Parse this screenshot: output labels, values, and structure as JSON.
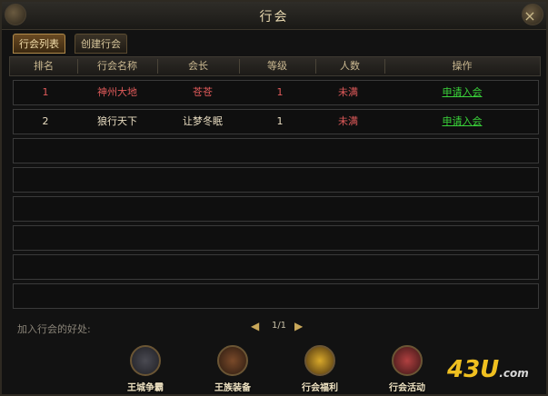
{
  "window": {
    "title": "行会"
  },
  "tabs": [
    {
      "label": "行会列表",
      "active": true
    },
    {
      "label": "创建行会",
      "active": false
    }
  ],
  "table": {
    "headers": [
      "排名",
      "行会名称",
      "会长",
      "等级",
      "人数",
      "操作"
    ],
    "rows": [
      {
        "rank": "1",
        "name": "神州大地",
        "leader": "苍苍",
        "level": "1",
        "people": "未满",
        "action": "申请入会"
      },
      {
        "rank": "2",
        "name": "狼行天下",
        "leader": "让梦冬眠",
        "level": "1",
        "people": "未满",
        "action": "申请入会"
      }
    ],
    "empty_rows": 6
  },
  "benefits": {
    "label": "加入行会的好处:"
  },
  "pager": {
    "text": "1/1"
  },
  "features": [
    {
      "label": "王城争霸",
      "icon": "crossed-swords-icon"
    },
    {
      "label": "王族装备",
      "icon": "royal-gear-icon"
    },
    {
      "label": "行会福利",
      "icon": "gold-ingot-icon"
    },
    {
      "label": "行会活动",
      "icon": "activity-icon"
    }
  ],
  "watermark": {
    "brand": "43U",
    "suffix": ".com"
  },
  "colors": {
    "row1_text": "#e05a5a",
    "row2_text": "#e8dcc0",
    "action": "#3ad43a",
    "people": "#e05a5a"
  }
}
